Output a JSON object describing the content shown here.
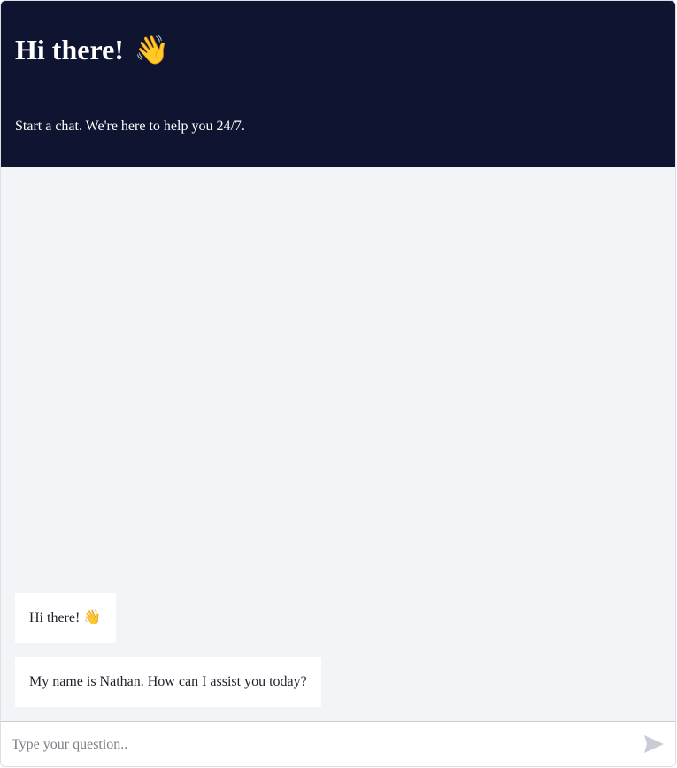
{
  "header": {
    "title": "Hi there!",
    "title_emoji": "👋",
    "subtitle": "Start a chat. We're here to help you 24/7."
  },
  "messages": [
    {
      "sender": "agent",
      "text": "Hi there! 👋"
    },
    {
      "sender": "agent",
      "text": "My name is Nathan. How can I assist you today?"
    }
  ],
  "composer": {
    "placeholder": "Type your question..",
    "value": "",
    "send_icon": "send-icon"
  },
  "colors": {
    "header_bg": "#0f1430",
    "body_bg": "#f3f4f7",
    "bubble_bg": "#ffffff",
    "send_icon": "#c9ccd4"
  }
}
